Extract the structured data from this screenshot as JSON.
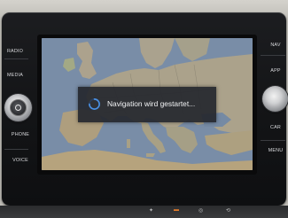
{
  "left_buttons": [
    {
      "label": "RADIO"
    },
    {
      "label": "MEDIA"
    },
    {
      "label": "PHONE"
    },
    {
      "label": "VOICE"
    }
  ],
  "right_buttons": [
    {
      "label": "NAV"
    },
    {
      "label": "APP"
    },
    {
      "label": "CAR"
    },
    {
      "label": "MENU"
    }
  ],
  "screen": {
    "dialog_text": "Navigation wird gestartet...",
    "spinner_icon": "loading-spinner-icon",
    "spinner_color": "#4a8fe0"
  },
  "colors": {
    "bezel": "#131416",
    "water": "#8196b2",
    "land": "#b7ad96"
  }
}
